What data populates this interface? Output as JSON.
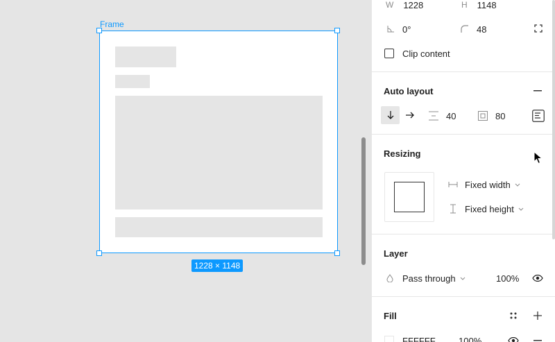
{
  "canvas": {
    "frame_label": "Frame",
    "size_badge": "1228 × 1148"
  },
  "panel": {
    "dimensions": {
      "w_label": "W",
      "w_value": "1228",
      "h_label": "H",
      "h_value": "1148",
      "rotation": "0°",
      "radius": "48"
    },
    "clip_content_label": "Clip content",
    "auto_layout": {
      "title": "Auto layout",
      "gap": "40",
      "padding": "80"
    },
    "resizing": {
      "title": "Resizing",
      "width_mode": "Fixed width",
      "height_mode": "Fixed height"
    },
    "layer": {
      "title": "Layer",
      "blend_mode": "Pass through",
      "opacity": "100%"
    },
    "fill": {
      "title": "Fill",
      "hex": "FFFFFF",
      "opacity": "100%"
    }
  }
}
